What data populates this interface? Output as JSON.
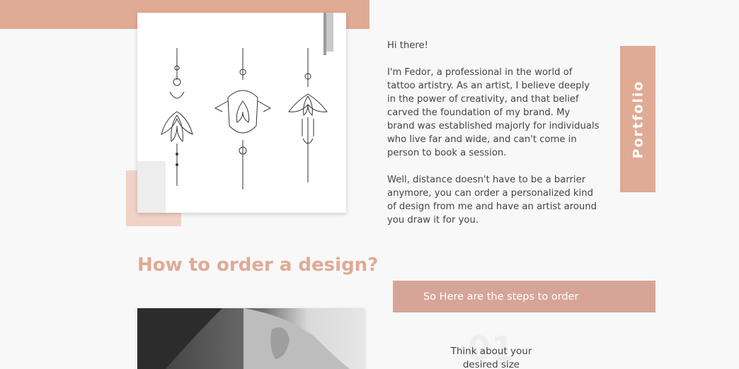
{
  "about": {
    "greeting": "Hi there!",
    "paragraph1": "I'm Fedor, a professional in the world of tattoo artistry. As an artist, I believe deeply in the power of creativity, and that belief carved the foundation of my brand. My brand was established majorly for individuals who live far and wide, and can't come in person to book a session.",
    "paragraph2": "Well, distance doesn't have to be a barrier anymore, you can order a personalized kind of design from me and have an artist around you draw it for you."
  },
  "portfolio_label": "Portfolio",
  "order_section": {
    "title": "How to order a design?",
    "steps_button": "So Here are the steps to order",
    "step1": {
      "number": "01",
      "text": "Think about your desired size"
    }
  },
  "colors": {
    "accent": "#dfab94",
    "steps_bar": "#d6a597",
    "soft_accent": "#f1d2c6"
  }
}
